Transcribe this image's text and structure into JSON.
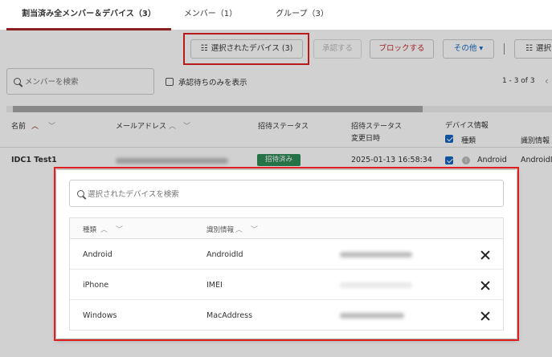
{
  "tabs": [
    {
      "label": "割当済み全メンバー＆デバイス（3）"
    },
    {
      "label": "メンバー（1）"
    },
    {
      "label": "グループ（3）"
    }
  ],
  "toolbar": {
    "selected_devices_label": "選択されたデバイス (3)",
    "approve_label": "承認する",
    "block_label": "ブロックする",
    "other_label": "その他",
    "other_caret": "▾",
    "select_label": "選択"
  },
  "filter": {
    "search_placeholder": "メンバーを検索",
    "pending_only_label": "承認待ちのみを表示",
    "pagination": "1 - 3 of 3",
    "prev_page": "‹"
  },
  "table": {
    "headers": {
      "name": "名前",
      "email": "メールアドレス",
      "invite_status": "招待ステータス",
      "invite_status_changed_line1": "招待ステータス",
      "invite_status_changed_line2": "変更日時",
      "device_info": "デバイス情報",
      "device_type": "種類",
      "device_id": "識別情報"
    },
    "sort_up": "︿",
    "sort_down": "﹀",
    "rows": [
      {
        "name": "IDC1 Test1",
        "status": "招待済み",
        "changed_at": "2025-01-13 16:58:34",
        "device_type": "Android",
        "device_id": "AndroidId"
      }
    ]
  },
  "modal": {
    "search_placeholder": "選択されたデバイスを検索",
    "headers": {
      "type": "種類",
      "id_info": "識別情報"
    },
    "rows": [
      {
        "type": "Android",
        "id_info": "AndroidId"
      },
      {
        "type": "iPhone",
        "id_info": "IMEI"
      },
      {
        "type": "Windows",
        "id_info": "MacAddress"
      }
    ]
  },
  "colors": {
    "accent": "#8b2020",
    "highlight": "#e02020",
    "badge": "#2e8b57",
    "checkbox": "#1565c0"
  }
}
